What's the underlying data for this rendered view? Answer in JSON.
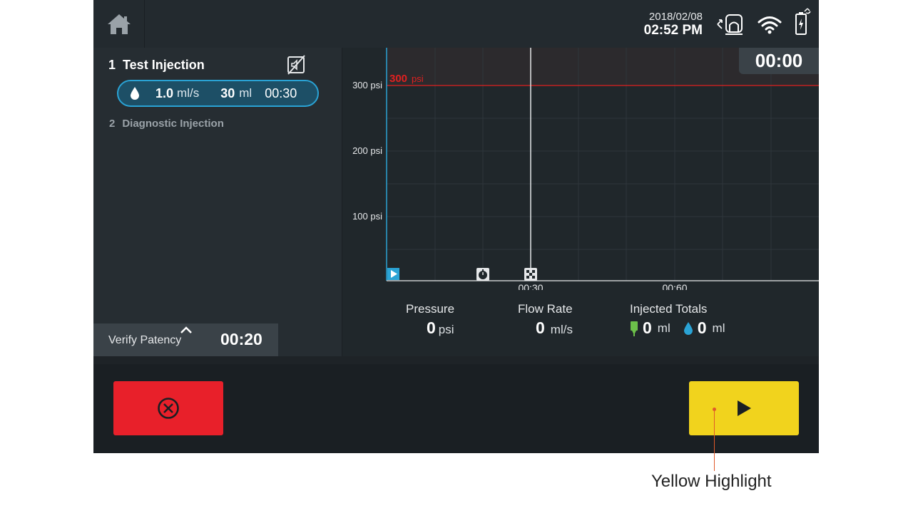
{
  "status": {
    "date": "2018/02/08",
    "time": "02:52 PM"
  },
  "protocol": {
    "steps": [
      {
        "number": "1",
        "name": "Test Injection"
      },
      {
        "number": "2",
        "name": "Diagnostic Injection"
      }
    ],
    "phase": {
      "flow_rate": "1.0",
      "flow_unit": "ml/s",
      "volume": "30",
      "volume_unit": "ml",
      "duration": "00:30"
    },
    "verify_patency": {
      "label": "Verify Patency",
      "time": "00:20"
    }
  },
  "chart": {
    "elapsed": "00:00",
    "limit_value": "300",
    "limit_unit": "psi",
    "y_ticks": [
      "300 psi",
      "200 psi",
      "100 psi"
    ],
    "x_ticks": [
      "00:30",
      "00:60"
    ]
  },
  "readouts": {
    "pressure": {
      "label": "Pressure",
      "value": "0",
      "unit": "psi"
    },
    "flow_rate": {
      "label": "Flow Rate",
      "value": "0",
      "unit": "ml/s"
    },
    "injected": {
      "label": "Injected Totals",
      "contrast_value": "0",
      "contrast_unit": "ml",
      "saline_value": "0",
      "saline_unit": "ml"
    }
  },
  "annotation": {
    "text": "Yellow Highlight"
  },
  "colors": {
    "stop_button": "#e8202a",
    "start_button": "#f1d31d",
    "limit_line": "#e02020",
    "accent_blue": "#2aa3d5",
    "contrast_green": "#6cc04a"
  }
}
